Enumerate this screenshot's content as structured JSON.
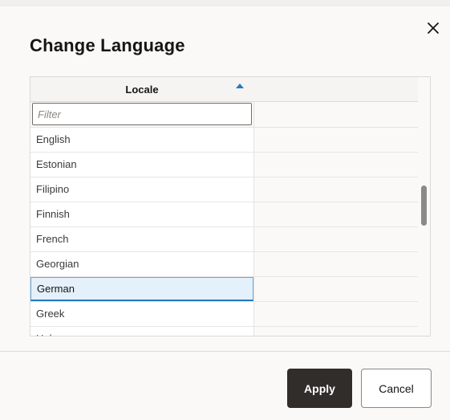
{
  "dialog": {
    "title": "Change Language",
    "close_icon": "close-icon"
  },
  "grid": {
    "column_header": "Locale",
    "sort_icon": "sort-ascending-icon",
    "filter_placeholder": "Filter",
    "rows": [
      "English",
      "Estonian",
      "Filipino",
      "Finnish",
      "French",
      "Georgian",
      "German",
      "Greek",
      "Hebrew"
    ],
    "selected_row": "German",
    "accent_color": "#227bc2"
  },
  "footer": {
    "apply_label": "Apply",
    "cancel_label": "Cancel"
  }
}
